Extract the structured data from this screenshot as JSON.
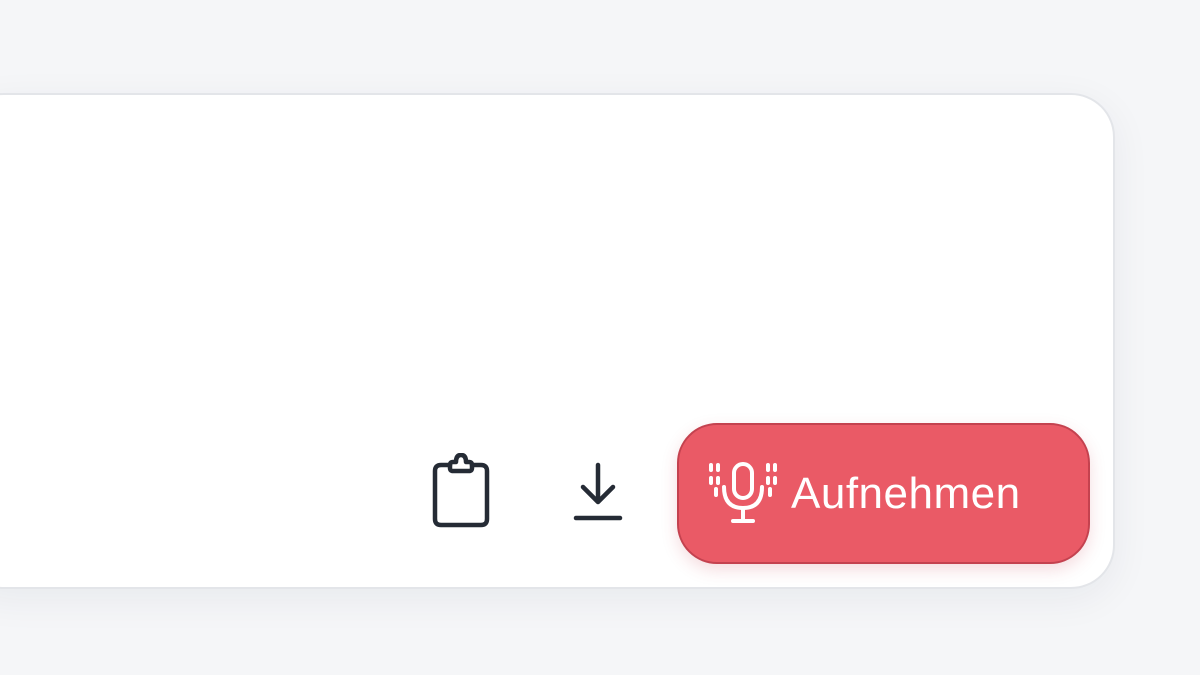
{
  "toolbar": {
    "copy_icon": "clipboard-icon",
    "download_icon": "download-icon",
    "record_icon": "microphone-icon",
    "record_label": "Aufnehmen"
  },
  "colors": {
    "page_background": "#f5f6f8",
    "card_background": "#ffffff",
    "icon_stroke": "#252b35",
    "record_button": "#ea5a66",
    "record_button_border": "#c4424f",
    "record_text": "#ffffff"
  }
}
